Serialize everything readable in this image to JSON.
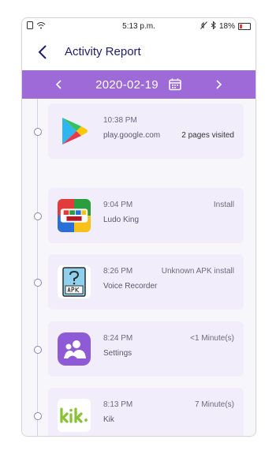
{
  "status_bar": {
    "time": "5:13 p.m.",
    "battery": "18%"
  },
  "header": {
    "title": "Activity Report"
  },
  "date_bar": {
    "date": "2020-02-19"
  },
  "activities": [
    {
      "time": "10:38 PM",
      "app": "play.google.com",
      "detail": "2 pages visited",
      "icon": "google-play-icon"
    },
    {
      "time": "9:04 PM",
      "app": "Ludo King",
      "detail": "Install",
      "icon": "ludo-king-icon"
    },
    {
      "time": "8:26 PM",
      "app": "Voice Recorder",
      "detail": "Unknown APK install",
      "icon": "apk-icon"
    },
    {
      "time": "8:24 PM",
      "app": "Settings",
      "detail": "<1 Minute(s)",
      "icon": "settings-app-icon"
    },
    {
      "time": "8:13 PM",
      "app": "Kik",
      "detail": "7 Minute(s)",
      "icon": "kik-icon"
    }
  ],
  "colors": {
    "accent": "#9d6ad8",
    "card": "#f1edfb",
    "title": "#1d1d6b"
  }
}
